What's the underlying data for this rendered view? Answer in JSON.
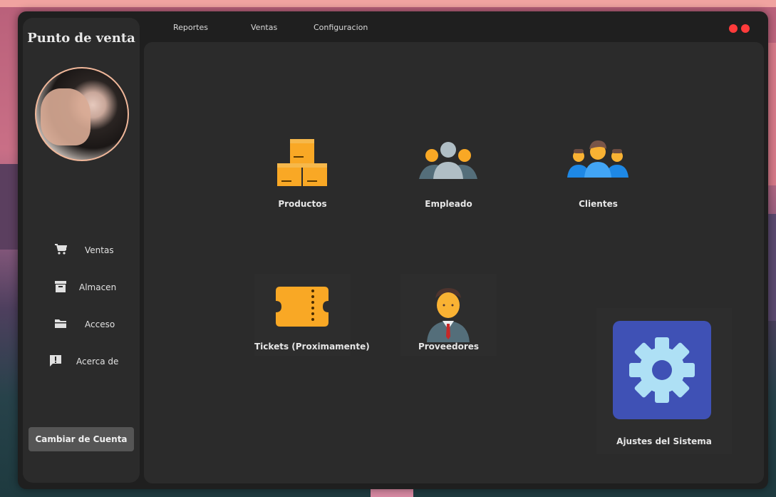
{
  "app": {
    "title": "Punto de venta"
  },
  "menubar": {
    "items": [
      "Reportes",
      "Ventas",
      "Configuracion"
    ]
  },
  "sidebar": {
    "avatar": "profile-photo",
    "items": [
      {
        "label": "Ventas",
        "icon": "cart-icon"
      },
      {
        "label": "Almacen",
        "icon": "archive-icon"
      },
      {
        "label": "Acceso",
        "icon": "folder-icon"
      },
      {
        "label": "Acerca de",
        "icon": "alert-message-icon"
      }
    ],
    "switch_account": "Cambiar de Cuenta"
  },
  "modules": [
    {
      "label": "Productos",
      "icon": "boxes-icon"
    },
    {
      "label": "Empleado",
      "icon": "group-icon"
    },
    {
      "label": "Clientes",
      "icon": "clients-icon"
    },
    {
      "label": "Tickets (Proximamente)",
      "icon": "ticket-icon"
    },
    {
      "label": "Proveedores",
      "icon": "businessman-icon"
    }
  ],
  "settings": {
    "label": "Ajustes del Sistema",
    "icon": "gear-icon"
  },
  "colors": {
    "accent_orange": "#f9a825",
    "settings_blue": "#3f51b5",
    "close_red": "#ff3b3b"
  }
}
